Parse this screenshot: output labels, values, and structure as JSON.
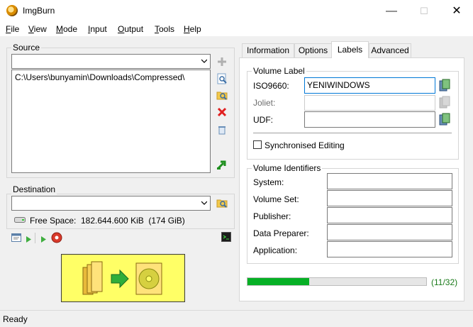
{
  "window": {
    "title": "ImgBurn",
    "minimize": "—",
    "maximize": "☐",
    "close": "✕"
  },
  "menu": [
    {
      "label": "File",
      "u": "F",
      "rest": "ile"
    },
    {
      "label": "View",
      "u": "V",
      "rest": "iew"
    },
    {
      "label": "Mode",
      "u": "M",
      "rest": "ode"
    },
    {
      "label": "Input",
      "u": "I",
      "rest": "nput"
    },
    {
      "label": "Output",
      "u": "O",
      "rest": "utput"
    },
    {
      "label": "Tools",
      "u": "T",
      "rest": "ools"
    },
    {
      "label": "Help",
      "u": "H",
      "rest": "elp"
    }
  ],
  "source": {
    "group_label": "Source",
    "combo_value": "",
    "items": [
      "C:\\Users\\bunyamin\\Downloads\\Compressed\\"
    ]
  },
  "destination": {
    "group_label": "Destination",
    "combo_value": "",
    "free_space_label": "Free Space:",
    "free_space_value": "182.644.600 KiB  (174 GiB)"
  },
  "tabs": [
    {
      "label": "Information",
      "active": false
    },
    {
      "label": "Options",
      "active": false
    },
    {
      "label": "Labels",
      "active": true
    },
    {
      "label": "Advanced",
      "active": false
    }
  ],
  "labels_tab": {
    "volume_label_group": "Volume Label",
    "iso9660_label": "ISO9660:",
    "iso9660_value": "YENIWINDOWS",
    "joliet_label": "Joliet:",
    "joliet_value": "",
    "udf_label": "UDF:",
    "udf_value": "",
    "sync_editing_label": "Synchronised Editing",
    "sync_editing_checked": false,
    "volume_identifiers_group": "Volume Identifiers",
    "system_label": "System:",
    "volume_set_label": "Volume Set:",
    "publisher_label": "Publisher:",
    "data_preparer_label": "Data Preparer:",
    "application_label": "Application:"
  },
  "progress": {
    "count_text": "(11/32)",
    "fraction": 0.34375,
    "color": "#06b025"
  },
  "status": {
    "text": "Ready"
  },
  "colors": {
    "build_button_bg": "#ffff66",
    "accent": "#0078d7"
  }
}
